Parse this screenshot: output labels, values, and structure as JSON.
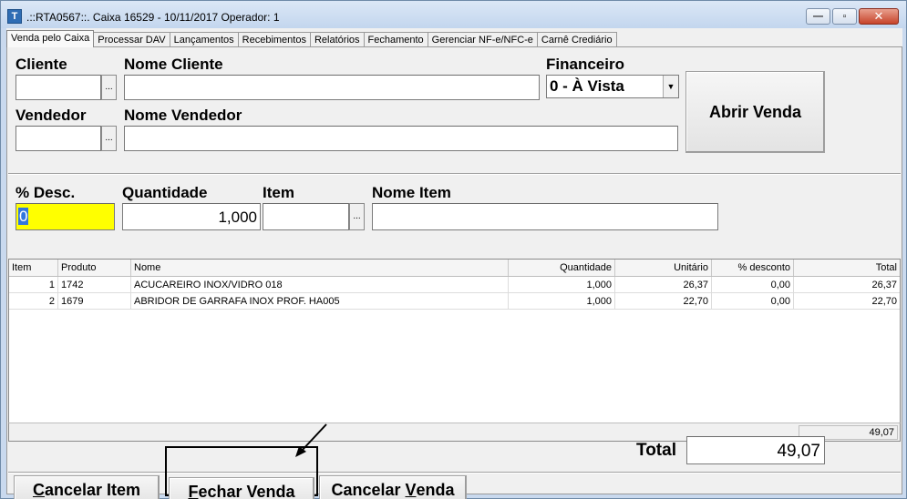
{
  "window": {
    "title": ".::RTA0567::. Caixa 16529 - 10/11/2017 Operador: 1",
    "minimize_glyph": "—",
    "maximize_glyph": "▫",
    "close_glyph": "✕"
  },
  "tabs": [
    {
      "label": "Venda pelo Caixa",
      "active": true
    },
    {
      "label": "Processar DAV"
    },
    {
      "label": "Lançamentos"
    },
    {
      "label": "Recebimentos"
    },
    {
      "label": "Relatórios"
    },
    {
      "label": "Fechamento"
    },
    {
      "label": "Gerenciar NF-e/NFC-e"
    },
    {
      "label": "Carnê Crediário"
    }
  ],
  "header": {
    "cliente_label": "Cliente",
    "cliente_value": "",
    "nome_cliente_label": "Nome Cliente",
    "nome_cliente_value": "",
    "financeiro_label": "Financeiro",
    "financeiro_value": "0 - À Vista",
    "vendedor_label": "Vendedor",
    "vendedor_value": "",
    "nome_vendedor_label": "Nome Vendedor",
    "nome_vendedor_value": "",
    "ellipsis": "...",
    "abrir_venda": "Abrir Venda"
  },
  "item_entry": {
    "desc_label": "% Desc.",
    "desc_value": "0",
    "quantidade_label": "Quantidade",
    "quantidade_value": "1,000",
    "item_label": "Item",
    "item_value": "",
    "nome_item_label": "Nome Item",
    "nome_item_value": ""
  },
  "grid": {
    "columns": [
      "Item",
      "Produto",
      "Nome",
      "Quantidade",
      "Unitário",
      "% desconto",
      "Total"
    ],
    "rows": [
      {
        "item": "1",
        "produto": "1742",
        "nome": "ACUCAREIRO INOX/VIDRO 018",
        "quantidade": "1,000",
        "unitario": "26,37",
        "desconto": "0,00",
        "total": "26,37"
      },
      {
        "item": "2",
        "produto": "1679",
        "nome": "ABRIDOR DE GARRAFA INOX PROF. HA005",
        "quantidade": "1,000",
        "unitario": "22,70",
        "desconto": "0,00",
        "total": "22,70"
      }
    ],
    "footer_total": "49,07"
  },
  "totals": {
    "total_label": "Total",
    "total_value": "49,07"
  },
  "actions": {
    "cancelar_item_first": "C",
    "cancelar_item_rest": "ancelar Item",
    "fechar_venda_first": "F",
    "fechar_venda_rest": "echar Venda",
    "cancelar_venda_pre": "Cancelar ",
    "cancelar_venda_u": "V",
    "cancelar_venda_rest": "enda"
  },
  "colors": {
    "desc_field_bg": "#ffff00",
    "selection_bg": "#3377dd"
  }
}
